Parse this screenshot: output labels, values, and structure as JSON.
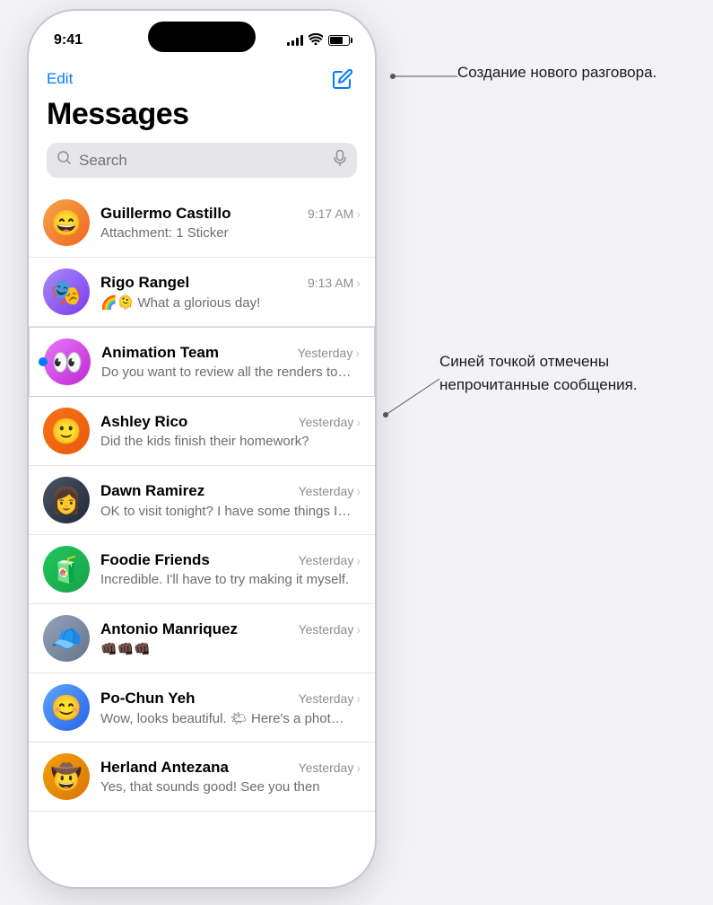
{
  "statusBar": {
    "time": "9:41",
    "icons": [
      "signal",
      "wifi",
      "battery"
    ]
  },
  "header": {
    "editLabel": "Edit",
    "title": "Messages",
    "composeIcon": "compose-icon"
  },
  "search": {
    "placeholder": "Search"
  },
  "conversations": [
    {
      "id": "guillermo",
      "name": "Guillermo Castillo",
      "time": "9:17 AM",
      "preview": "Attachment: 1 Sticker",
      "avatar": "😄",
      "avatarClass": "avatar-guillermo",
      "unread": false
    },
    {
      "id": "rigo",
      "name": "Rigo Rangel",
      "time": "9:13 AM",
      "preview": "🌈🫠 What a glorious day!",
      "avatar": "🎭",
      "avatarClass": "avatar-rigo",
      "unread": false
    },
    {
      "id": "animation",
      "name": "Animation Team",
      "time": "Yesterday",
      "preview": "Do you want to review all the renders together next time we meet and decide o…",
      "avatar": "👀",
      "avatarClass": "avatar-animation",
      "unread": true
    },
    {
      "id": "ashley",
      "name": "Ashley Rico",
      "time": "Yesterday",
      "preview": "Did the kids finish their homework?",
      "avatar": "🙂",
      "avatarClass": "avatar-ashley",
      "unread": false
    },
    {
      "id": "dawn",
      "name": "Dawn Ramirez",
      "time": "Yesterday",
      "preview": "OK to visit tonight? I have some things I need the grandkids' help with. 🥰",
      "avatar": "👩",
      "avatarClass": "avatar-dawn",
      "unread": false
    },
    {
      "id": "foodie",
      "name": "Foodie Friends",
      "time": "Yesterday",
      "preview": "Incredible. I'll have to try making it myself.",
      "avatar": "🧃",
      "avatarClass": "avatar-foodie",
      "unread": false
    },
    {
      "id": "antonio",
      "name": "Antonio Manriquez",
      "time": "Yesterday",
      "preview": "👊🏿👊🏿👊🏿",
      "avatar": "🧢",
      "avatarClass": "avatar-antonio",
      "unread": false
    },
    {
      "id": "pochun",
      "name": "Po-Chun Yeh",
      "time": "Yesterday",
      "preview": "Wow, looks beautiful. 🌤 Here's a photo of the beach!",
      "avatar": "😊",
      "avatarClass": "avatar-pochun",
      "unread": false
    },
    {
      "id": "herland",
      "name": "Herland Antezana",
      "time": "Yesterday",
      "preview": "Yes, that sounds good! See you then",
      "avatar": "🤠",
      "avatarClass": "avatar-herland",
      "unread": false
    }
  ],
  "annotations": {
    "compose": "Создание нового\nразговора.",
    "unread": "Синей точкой\nотмечены\nнепрочитанные\nсообщения."
  }
}
